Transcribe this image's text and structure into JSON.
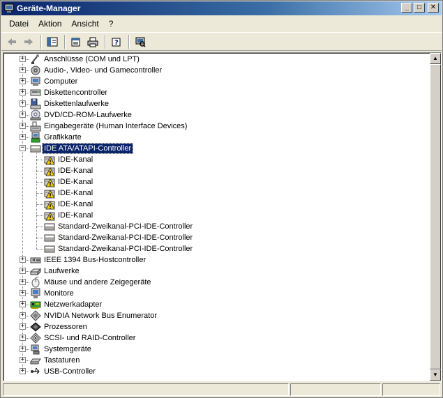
{
  "window": {
    "title": "Geräte-Manager",
    "minimize": "_",
    "maximize": "□",
    "close": "✕"
  },
  "menu": [
    "Datei",
    "Aktion",
    "Ansicht",
    "?"
  ],
  "toolbar": {
    "buttons": [
      "back-arrow-icon",
      "forward-arrow-icon",
      "console-tree-icon",
      "properties-icon",
      "print-icon",
      "help-icon",
      "scan-hardware-icon"
    ]
  },
  "tree": {
    "categories": [
      {
        "label": "Anschlüsse (COM und LPT)",
        "icon": "port-icon",
        "expanded": false
      },
      {
        "label": "Audio-, Video- und Gamecontroller",
        "icon": "sound-icon",
        "expanded": false
      },
      {
        "label": "Computer",
        "icon": "computer-icon",
        "expanded": false
      },
      {
        "label": "Diskettencontroller",
        "icon": "floppy-controller-icon",
        "expanded": false
      },
      {
        "label": "Diskettenlaufwerke",
        "icon": "floppy-drive-icon",
        "expanded": false
      },
      {
        "label": "DVD/CD-ROM-Laufwerke",
        "icon": "cdrom-icon",
        "expanded": false
      },
      {
        "label": "Eingabegeräte (Human Interface Devices)",
        "icon": "hid-icon",
        "expanded": false
      },
      {
        "label": "Grafikkarte",
        "icon": "display-adapter-icon",
        "expanded": false
      },
      {
        "label": "IDE ATA/ATAPI-Controller",
        "icon": "ide-controller-icon",
        "expanded": true,
        "selected": true,
        "children": [
          {
            "label": "IDE-Kanal",
            "icon": "ide-channel-warning-icon"
          },
          {
            "label": "IDE-Kanal",
            "icon": "ide-channel-warning-icon"
          },
          {
            "label": "IDE-Kanal",
            "icon": "ide-channel-warning-icon"
          },
          {
            "label": "IDE-Kanal",
            "icon": "ide-channel-warning-icon"
          },
          {
            "label": "IDE-Kanal",
            "icon": "ide-channel-warning-icon"
          },
          {
            "label": "IDE-Kanal",
            "icon": "ide-channel-warning-icon"
          },
          {
            "label": "Standard-Zweikanal-PCI-IDE-Controller",
            "icon": "ide-controller-icon"
          },
          {
            "label": "Standard-Zweikanal-PCI-IDE-Controller",
            "icon": "ide-controller-icon"
          },
          {
            "label": "Standard-Zweikanal-PCI-IDE-Controller",
            "icon": "ide-controller-icon"
          }
        ]
      },
      {
        "label": "IEEE 1394 Bus-Hostcontroller",
        "icon": "ieee1394-icon",
        "expanded": false
      },
      {
        "label": "Laufwerke",
        "icon": "disk-drive-icon",
        "expanded": false
      },
      {
        "label": "Mäuse und andere Zeigegeräte",
        "icon": "mouse-icon",
        "expanded": false
      },
      {
        "label": "Monitore",
        "icon": "monitor-icon",
        "expanded": false
      },
      {
        "label": "Netzwerkadapter",
        "icon": "network-adapter-icon",
        "expanded": false
      },
      {
        "label": "NVIDIA Network Bus Enumerator",
        "icon": "bus-enumerator-icon",
        "expanded": false
      },
      {
        "label": "Prozessoren",
        "icon": "processor-icon",
        "expanded": false
      },
      {
        "label": "SCSI- und RAID-Controller",
        "icon": "scsi-icon",
        "expanded": false
      },
      {
        "label": "Systemgeräte",
        "icon": "system-device-icon",
        "expanded": false
      },
      {
        "label": "Tastaturen",
        "icon": "keyboard-icon",
        "expanded": false
      },
      {
        "label": "USB-Controller",
        "icon": "usb-icon",
        "expanded": false
      }
    ]
  },
  "expander": {
    "collapsed": "+",
    "expanded": "−"
  },
  "scrollbar": {
    "up": "▲",
    "down": "▼"
  }
}
